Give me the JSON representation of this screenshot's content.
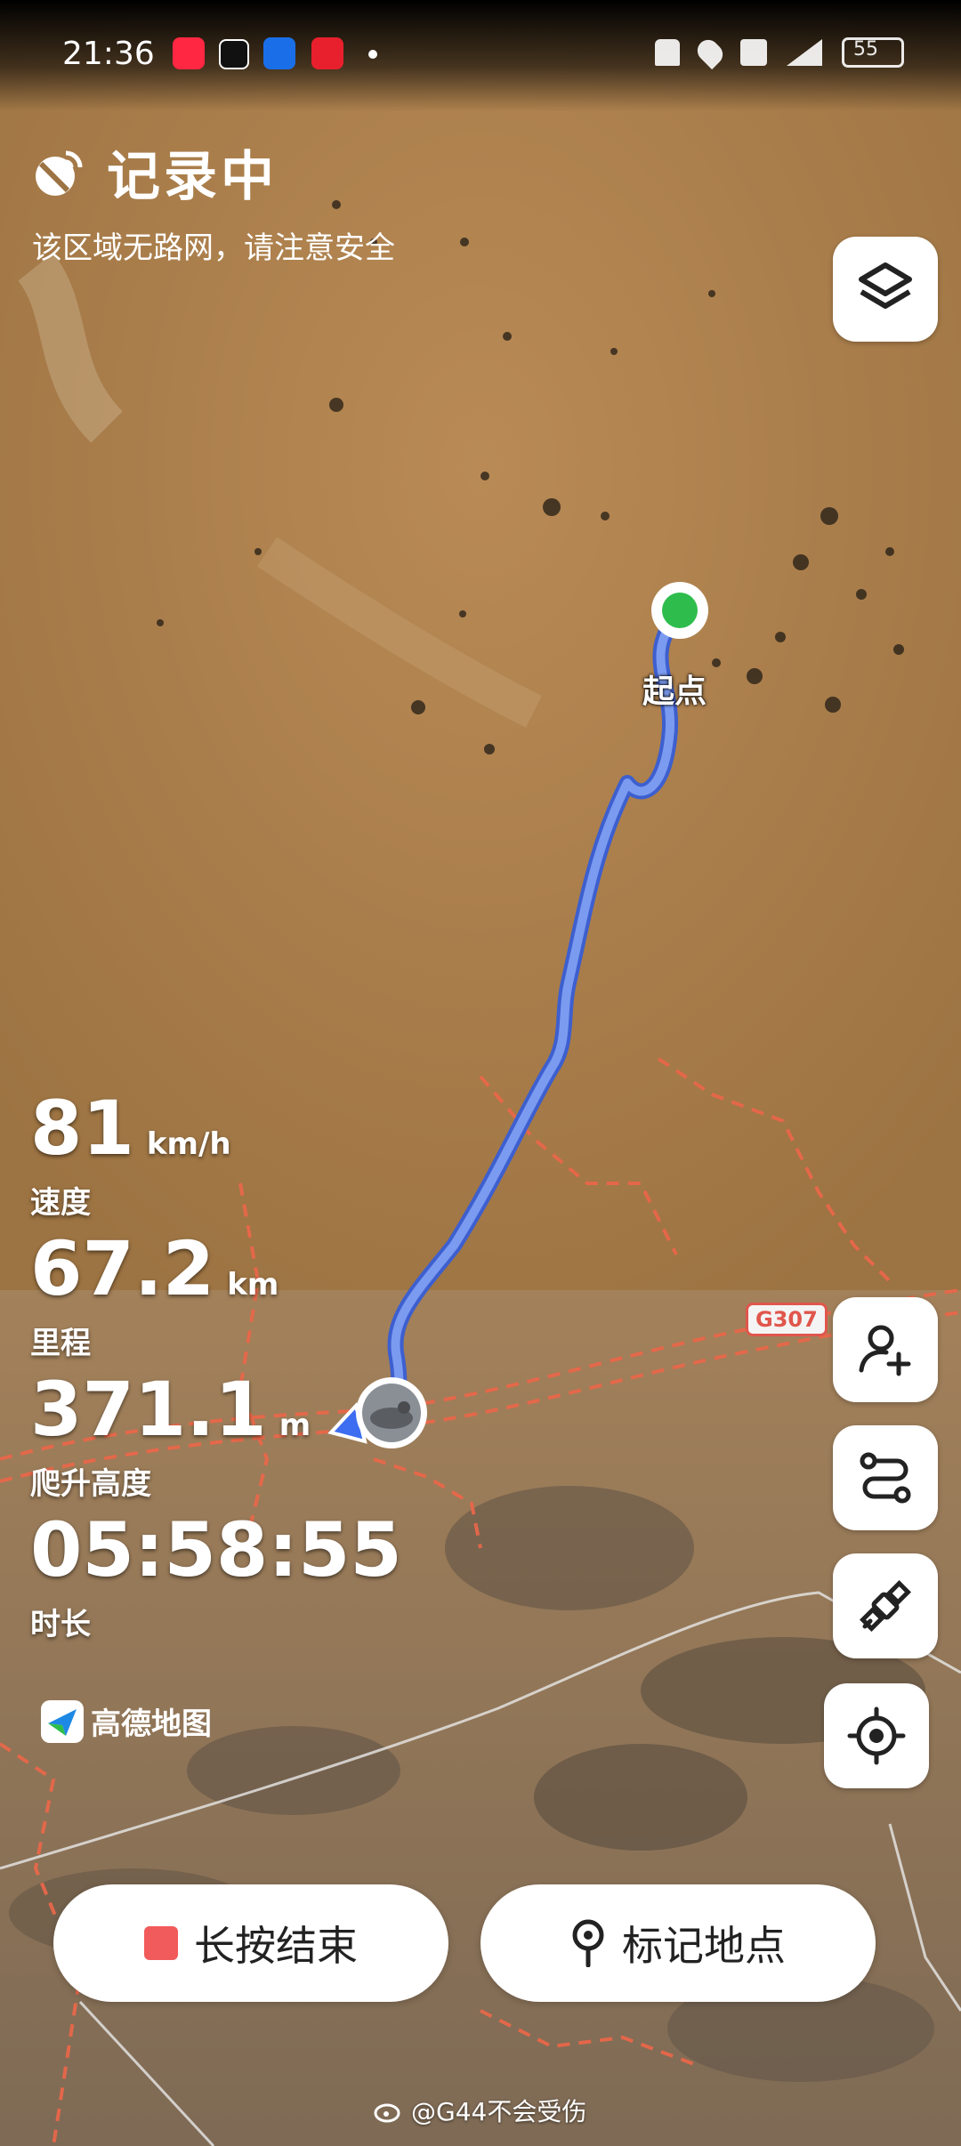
{
  "status_bar": {
    "time": "21:36",
    "battery": "55"
  },
  "recording": {
    "title": "记录中",
    "subtitle": "该区域无路网，请注意安全"
  },
  "map": {
    "start_label": "起点",
    "road_badge": "G307"
  },
  "stats": {
    "speed": {
      "value": "81",
      "unit": "km/h",
      "label": "速度"
    },
    "distance": {
      "value": "67.2",
      "unit": "km",
      "label": "里程"
    },
    "climb": {
      "value": "371.1",
      "unit": "m",
      "label": "爬升高度"
    },
    "duration": {
      "value": "05:58:55",
      "label": "时长"
    }
  },
  "logo": {
    "text": "高德地图"
  },
  "buttons": {
    "end": "长按结束",
    "mark": "标记地点"
  },
  "icons": {
    "layers": "layers-icon",
    "add_friend": "add-person-icon",
    "route": "route-icon",
    "satellite": "satellite-icon",
    "locate": "locate-icon"
  },
  "colors": {
    "track": "#6f8fe6",
    "start_dot": "#2ebd4c",
    "stop_square": "#f25b5b",
    "boundary": "#e8674a"
  },
  "watermark": "@G44不会受伤"
}
